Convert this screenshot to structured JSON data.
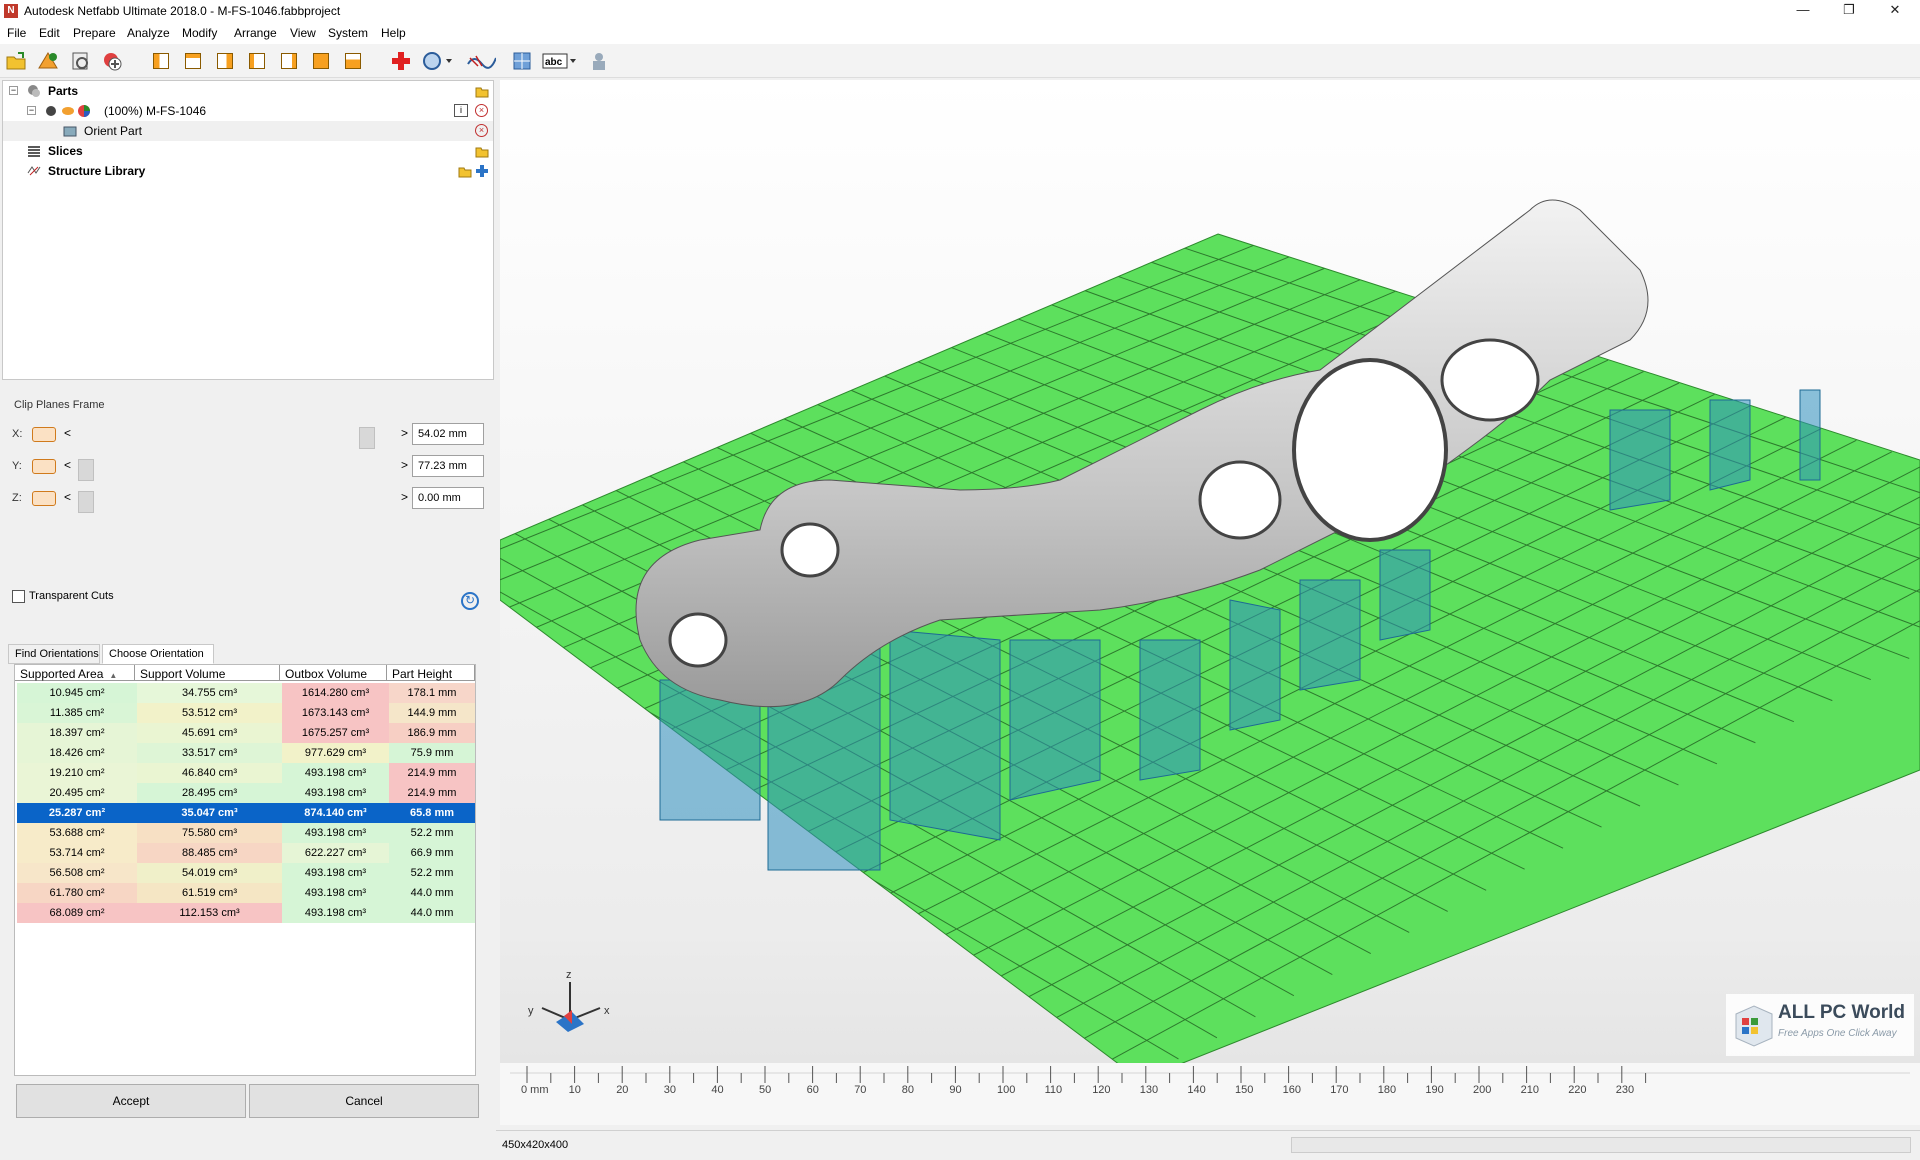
{
  "window": {
    "title": "Autodesk Netfabb Ultimate 2018.0 - M-FS-1046.fabbproject",
    "app_icon_letter": "N",
    "controls": {
      "minimize": "—",
      "restore": "❐",
      "close": "✕"
    }
  },
  "menu": [
    "File",
    "Edit",
    "Prepare",
    "Analyze",
    "Modify",
    "Arrange",
    "View",
    "System",
    "Help"
  ],
  "toolbar": {
    "icons": [
      "open-project-icon",
      "add-part-icon",
      "load-part-icon",
      "add-plus-icon",
      "view-front-icon",
      "view-back-icon",
      "view-left-icon",
      "view-right-icon",
      "view-top-icon",
      "view-bottom-icon",
      "view-iso-icon",
      "repair-cross-icon",
      "measure-icon",
      "slice-icon",
      "support-icon",
      "label-abc-icon",
      "person-icon"
    ]
  },
  "tree": {
    "parts_label": "Parts",
    "part_name": "(100%) M-FS-1046",
    "orient_label": "Orient Part",
    "slices_label": "Slices",
    "structure_label": "Structure Library"
  },
  "clip_planes": {
    "title": "Clip Planes Frame",
    "axes": [
      {
        "label": "X:",
        "value": "54.02 mm"
      },
      {
        "label": "Y:",
        "value": "77.23 mm"
      },
      {
        "label": "Z:",
        "value": "0.00 mm"
      }
    ],
    "transparent_label": "Transparent Cuts",
    "arrow_left": "<",
    "arrow_right": ">"
  },
  "tabs": [
    "Find Orientations",
    "Choose Orientation"
  ],
  "grid": {
    "headers": [
      "Supported Area",
      "Support Volume",
      "Outbox Volume",
      "Part Height"
    ],
    "sort_indicator": "▲",
    "selected_index": 6,
    "rows": [
      [
        "10.945 cm²",
        "34.755 cm³",
        "1614.280 cm³",
        "178.1 mm"
      ],
      [
        "11.385 cm²",
        "53.512 cm³",
        "1673.143 cm³",
        "144.9 mm"
      ],
      [
        "18.397 cm²",
        "45.691 cm³",
        "1675.257 cm³",
        "186.9 mm"
      ],
      [
        "18.426 cm²",
        "33.517 cm³",
        "977.629 cm³",
        "75.9 mm"
      ],
      [
        "19.210 cm²",
        "46.840 cm³",
        "493.198 cm³",
        "214.9 mm"
      ],
      [
        "20.495 cm²",
        "28.495 cm³",
        "493.198 cm³",
        "214.9 mm"
      ],
      [
        "25.287 cm²",
        "35.047 cm³",
        "874.140 cm³",
        "65.8 mm"
      ],
      [
        "53.688 cm²",
        "75.580 cm³",
        "493.198 cm³",
        "52.2 mm"
      ],
      [
        "53.714 cm²",
        "88.485 cm³",
        "622.227 cm³",
        "66.9 mm"
      ],
      [
        "56.508 cm²",
        "54.019 cm³",
        "493.198 cm³",
        "52.2 mm"
      ],
      [
        "61.780 cm²",
        "61.519 cm³",
        "493.198 cm³",
        "44.0 mm"
      ],
      [
        "68.089 cm²",
        "112.153 cm³",
        "493.198 cm³",
        "44.0 mm"
      ]
    ],
    "row_colors": [
      [
        "#d6f5d6",
        "#e6f7d9",
        "#f7c4c4",
        "#f7d6c9"
      ],
      [
        "#d9f5d6",
        "#f2f2c9",
        "#f7c4c4",
        "#f5e6c9"
      ],
      [
        "#e6f5d6",
        "#eaf5d2",
        "#f7c4c4",
        "#f7cfc4"
      ],
      [
        "#e6f5d6",
        "#def5d6",
        "#f2f2c9",
        "#d6f5d6"
      ],
      [
        "#eaf5d6",
        "#eaf5d2",
        "#d6f5d6",
        "#f7c4c4"
      ],
      [
        "#eaf5d6",
        "#d6f5d6",
        "#d6f5d6",
        "#f7c4c4"
      ],
      [
        "#0a64c8",
        "#0a64c8",
        "#0a64c8",
        "#0a64c8"
      ],
      [
        "#f7ebc9",
        "#f7e0c4",
        "#d6f5d6",
        "#d6f5d6"
      ],
      [
        "#f7ebc9",
        "#f7d6c4",
        "#e6f5d6",
        "#d6f5d6"
      ],
      [
        "#f7e6c9",
        "#f0f0c9",
        "#d6f5d6",
        "#d6f5d6"
      ],
      [
        "#f7d6c4",
        "#f5e6c4",
        "#d6f5d6",
        "#d6f5d6"
      ],
      [
        "#f7c4c4",
        "#f7c4c4",
        "#d6f5d6",
        "#d6f5d6"
      ]
    ]
  },
  "buttons": {
    "accept": "Accept",
    "cancel": "Cancel"
  },
  "viewport": {
    "axes": {
      "x": "x",
      "y": "y",
      "z": "z"
    },
    "platform_color": "#5de05d",
    "part_color": "#c9c9c9",
    "support_color": "#2e8fc0"
  },
  "ruler": {
    "labels": [
      "0 mm",
      "10",
      "20",
      "30",
      "40",
      "50",
      "60",
      "70",
      "80",
      "90",
      "100",
      "110",
      "120",
      "130",
      "140",
      "150",
      "160",
      "170",
      "180",
      "190",
      "200",
      "210",
      "220",
      "230"
    ]
  },
  "status": {
    "dims": "450x420x400"
  },
  "watermark": {
    "title": "ALL PC World",
    "subtitle": "Free Apps One Click Away"
  }
}
